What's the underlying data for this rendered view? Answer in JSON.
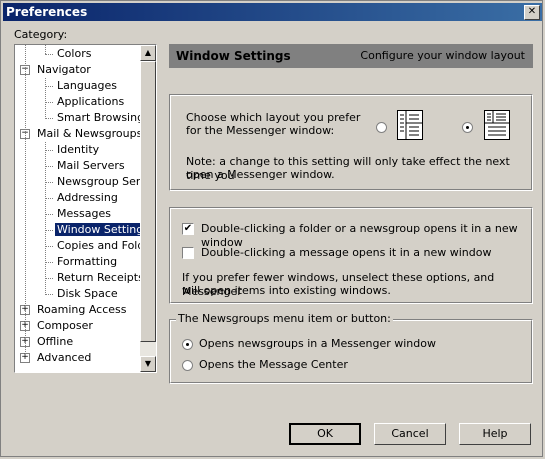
{
  "window": {
    "title": "Preferences",
    "close_glyph": "✕"
  },
  "category_label": "Category:",
  "tree": [
    {
      "label": "Colors",
      "level": 2
    },
    {
      "label": "Navigator",
      "level": 1,
      "expander": "−"
    },
    {
      "label": "Languages",
      "level": 2
    },
    {
      "label": "Applications",
      "level": 2
    },
    {
      "label": "Smart Browsing",
      "level": 2
    },
    {
      "label": "Mail & Newsgroups",
      "level": 1,
      "expander": "−"
    },
    {
      "label": "Identity",
      "level": 2
    },
    {
      "label": "Mail Servers",
      "level": 2
    },
    {
      "label": "Newsgroup Serve",
      "level": 2
    },
    {
      "label": "Addressing",
      "level": 2
    },
    {
      "label": "Messages",
      "level": 2
    },
    {
      "label": "Window Settings",
      "level": 2,
      "selected": true
    },
    {
      "label": "Copies and Folder",
      "level": 2
    },
    {
      "label": "Formatting",
      "level": 2
    },
    {
      "label": "Return Receipts",
      "level": 2
    },
    {
      "label": "Disk Space",
      "level": 2
    },
    {
      "label": "Roaming Access",
      "level": 1,
      "expander": "+"
    },
    {
      "label": "Composer",
      "level": 1,
      "expander": "+"
    },
    {
      "label": "Offline",
      "level": 1,
      "expander": "+"
    },
    {
      "label": "Advanced",
      "level": 1,
      "expander": "+"
    }
  ],
  "header": {
    "title": "Window Settings",
    "description": "Configure your window layout"
  },
  "layout": {
    "prompt_line1": "Choose which layout you prefer",
    "prompt_line2": "for the Messenger window:",
    "option1_selected": false,
    "option2_selected": true,
    "note_line1": "Note: a change to this setting will only take effect the next time you",
    "note_line2": "open a Messenger window."
  },
  "doubleclick": {
    "folder_label": "Double-clicking a folder or a newsgroup opens it in a new window",
    "folder_checked": true,
    "message_label": "Double-clicking a message opens it in a new window",
    "message_checked": false,
    "hint_line1": "If you prefer fewer windows, unselect these options, and Messenger",
    "hint_line2": "will open items into existing windows."
  },
  "newsgroups": {
    "group_label": "The Newsgroups menu item or button:",
    "option1": "Opens newsgroups in a Messenger window",
    "option1_selected": true,
    "option2": "Opens the Message Center",
    "option2_selected": false
  },
  "buttons": {
    "ok": "OK",
    "cancel": "Cancel",
    "help": "Help"
  }
}
